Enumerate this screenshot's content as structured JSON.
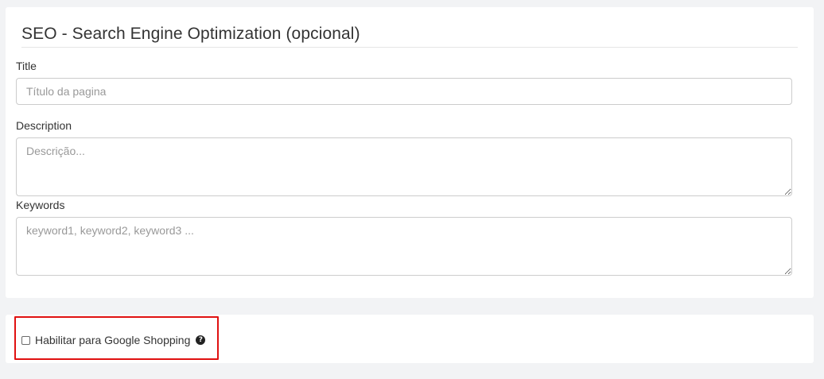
{
  "seo": {
    "title": "SEO - Search Engine Optimization (opcional)",
    "fields": {
      "title": {
        "label": "Title",
        "placeholder": "Título da pagina",
        "value": ""
      },
      "description": {
        "label": "Description",
        "placeholder": "Descrição...",
        "value": ""
      },
      "keywords": {
        "label": "Keywords",
        "placeholder": "keyword1, keyword2, keyword3 ...",
        "value": ""
      }
    }
  },
  "shopping": {
    "checkbox_label": "Habilitar para Google Shopping",
    "checked": false,
    "help_icon": "question-circle-icon",
    "highlight_color": "#e01111"
  },
  "colors": {
    "background": "#f2f3f5",
    "panel": "#ffffff",
    "input_border": "#cccccc"
  }
}
